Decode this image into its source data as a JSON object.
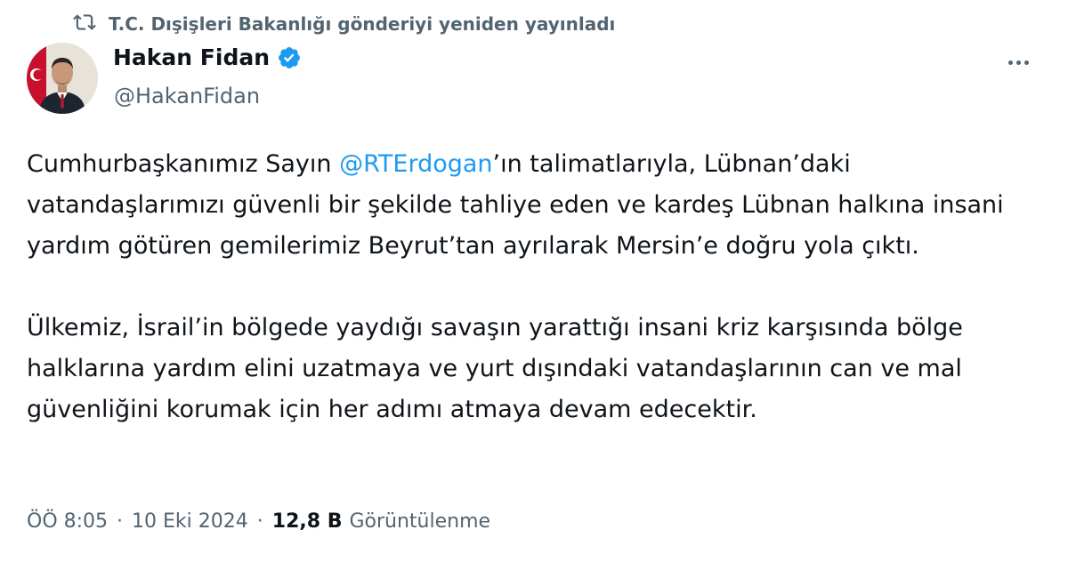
{
  "repost": {
    "text": "T.C. Dışişleri Bakanlığı gönderiyi yeniden yayınladı",
    "icon": "repost-icon"
  },
  "author": {
    "display_name": "Hakan Fidan",
    "handle": "@HakanFidan",
    "verified_icon": "verified-badge-icon"
  },
  "more_icon": "more-options-icon",
  "tweet": {
    "p1_before": "Cumhurbaşkanımız Sayın ",
    "mention": "@RTErdogan",
    "p1_after": "’ın talimatlarıyla, Lübnan’daki vatandaşlarımızı güvenli bir şekilde tahliye eden ve kardeş Lübnan halkına insani yardım götüren gemilerimiz Beyrut’tan ayrılarak Mersin’e doğru yola çıktı.",
    "p2": "Ülkemiz, İsrail’in bölgede yaydığı savaşın yarattığı insani kriz karşısında bölge halklarına yardım elini uzatmaya ve yurt dışındaki vatandaşlarının can ve mal güvenliğini korumak için her adımı atmaya devam edecektir."
  },
  "meta": {
    "time": "ÖÖ 8:05",
    "separator": "·",
    "date": "10 Eki 2024",
    "views_count": "12,8 B",
    "views_label": "Görüntülenme"
  },
  "colors": {
    "text": "#0f1419",
    "secondary": "#536471",
    "link": "#1d9bf0",
    "verified": "#1d9bf0"
  }
}
